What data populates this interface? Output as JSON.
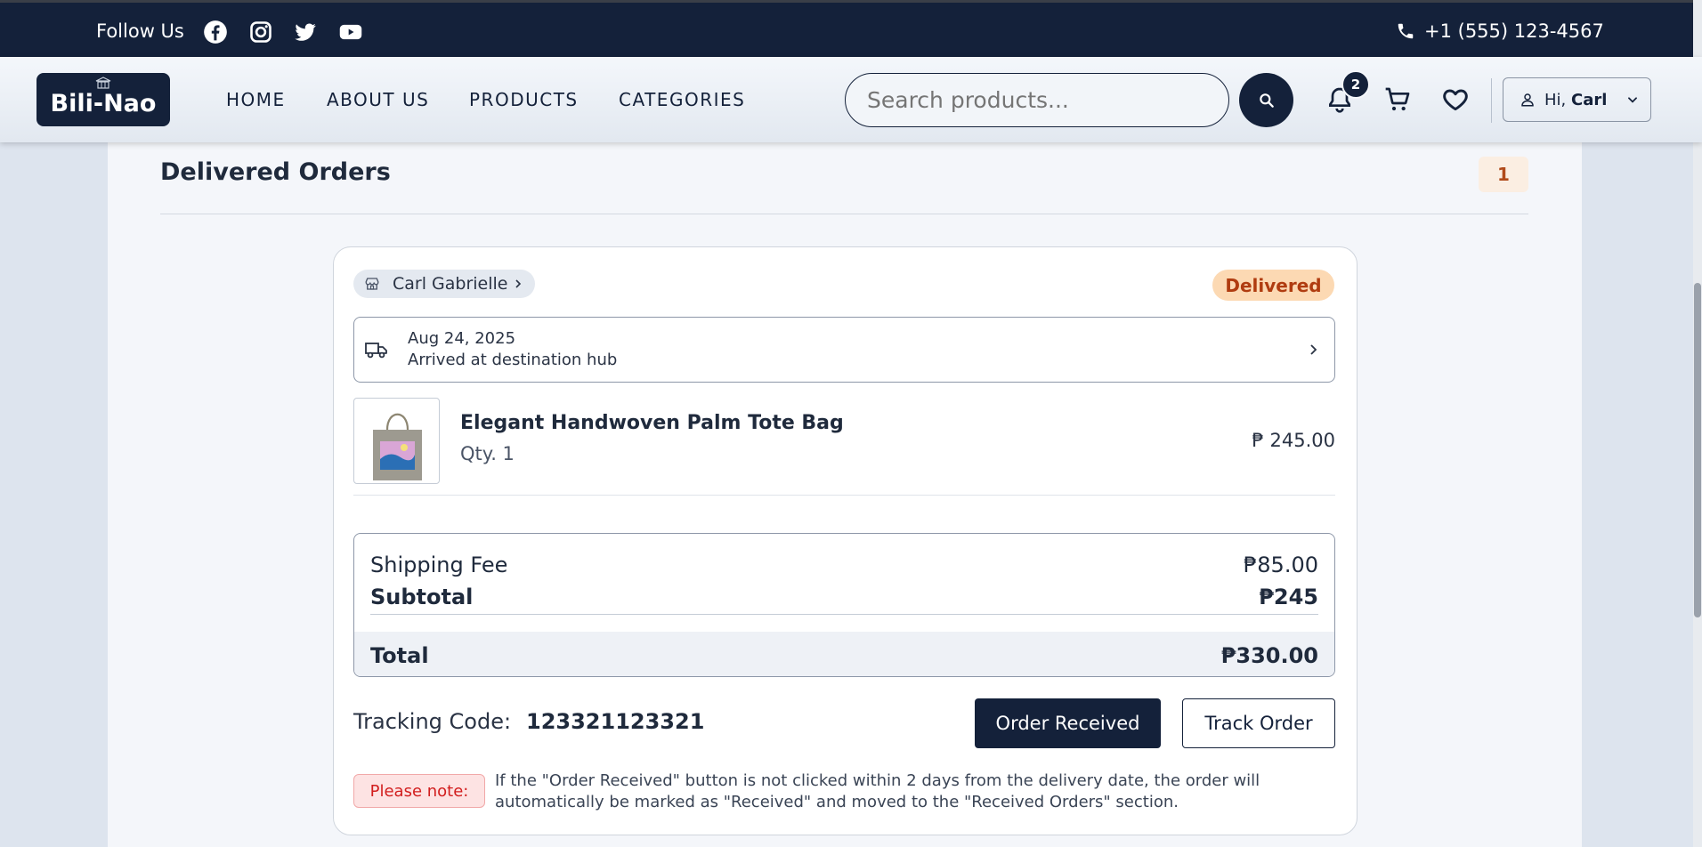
{
  "topbar": {
    "follow_label": "Follow Us",
    "social_icons": [
      "facebook-icon",
      "instagram-icon",
      "twitter-icon",
      "youtube-icon"
    ],
    "phone": "+1 (555) 123-4567"
  },
  "nav": {
    "logo_text": "Bili-Nao",
    "links": [
      "HOME",
      "ABOUT US",
      "PRODUCTS",
      "CATEGORIES"
    ],
    "search_placeholder": "Search products...",
    "notification_count": "2",
    "greeting": "Hi,",
    "user_name": "Carl"
  },
  "section": {
    "title": "Delivered Orders",
    "count": "1"
  },
  "order": {
    "shop_name": "Carl Gabrielle",
    "status": "Delivered",
    "shipping": {
      "date": "Aug 24, 2025",
      "status": "Arrived at destination hub"
    },
    "item": {
      "name": "Elegant Handwoven Palm Tote Bag",
      "qty": "Qty. 1",
      "price": "₱ 245.00"
    },
    "summary": {
      "shipping_label": "Shipping Fee",
      "shipping_value": "₱85.00",
      "subtotal_label": "Subtotal",
      "subtotal_value": "₱245",
      "total_label": "Total",
      "total_value": "₱330.00"
    },
    "tracking_label": "Tracking Code:",
    "tracking_code": "123321123321",
    "received_button": "Order Received",
    "track_button": "Track Order",
    "note_label": "Please note:",
    "note_text": "If the \"Order Received\" button is not clicked within 2 days from the delivery date, the order will automatically be marked as \"Received\" and moved to the \"Received Orders\" section."
  },
  "colors": {
    "navy": "#14213a",
    "status_bg": "#fcd9b3",
    "status_text": "#b03c10",
    "note_red": "#d21e1e"
  }
}
